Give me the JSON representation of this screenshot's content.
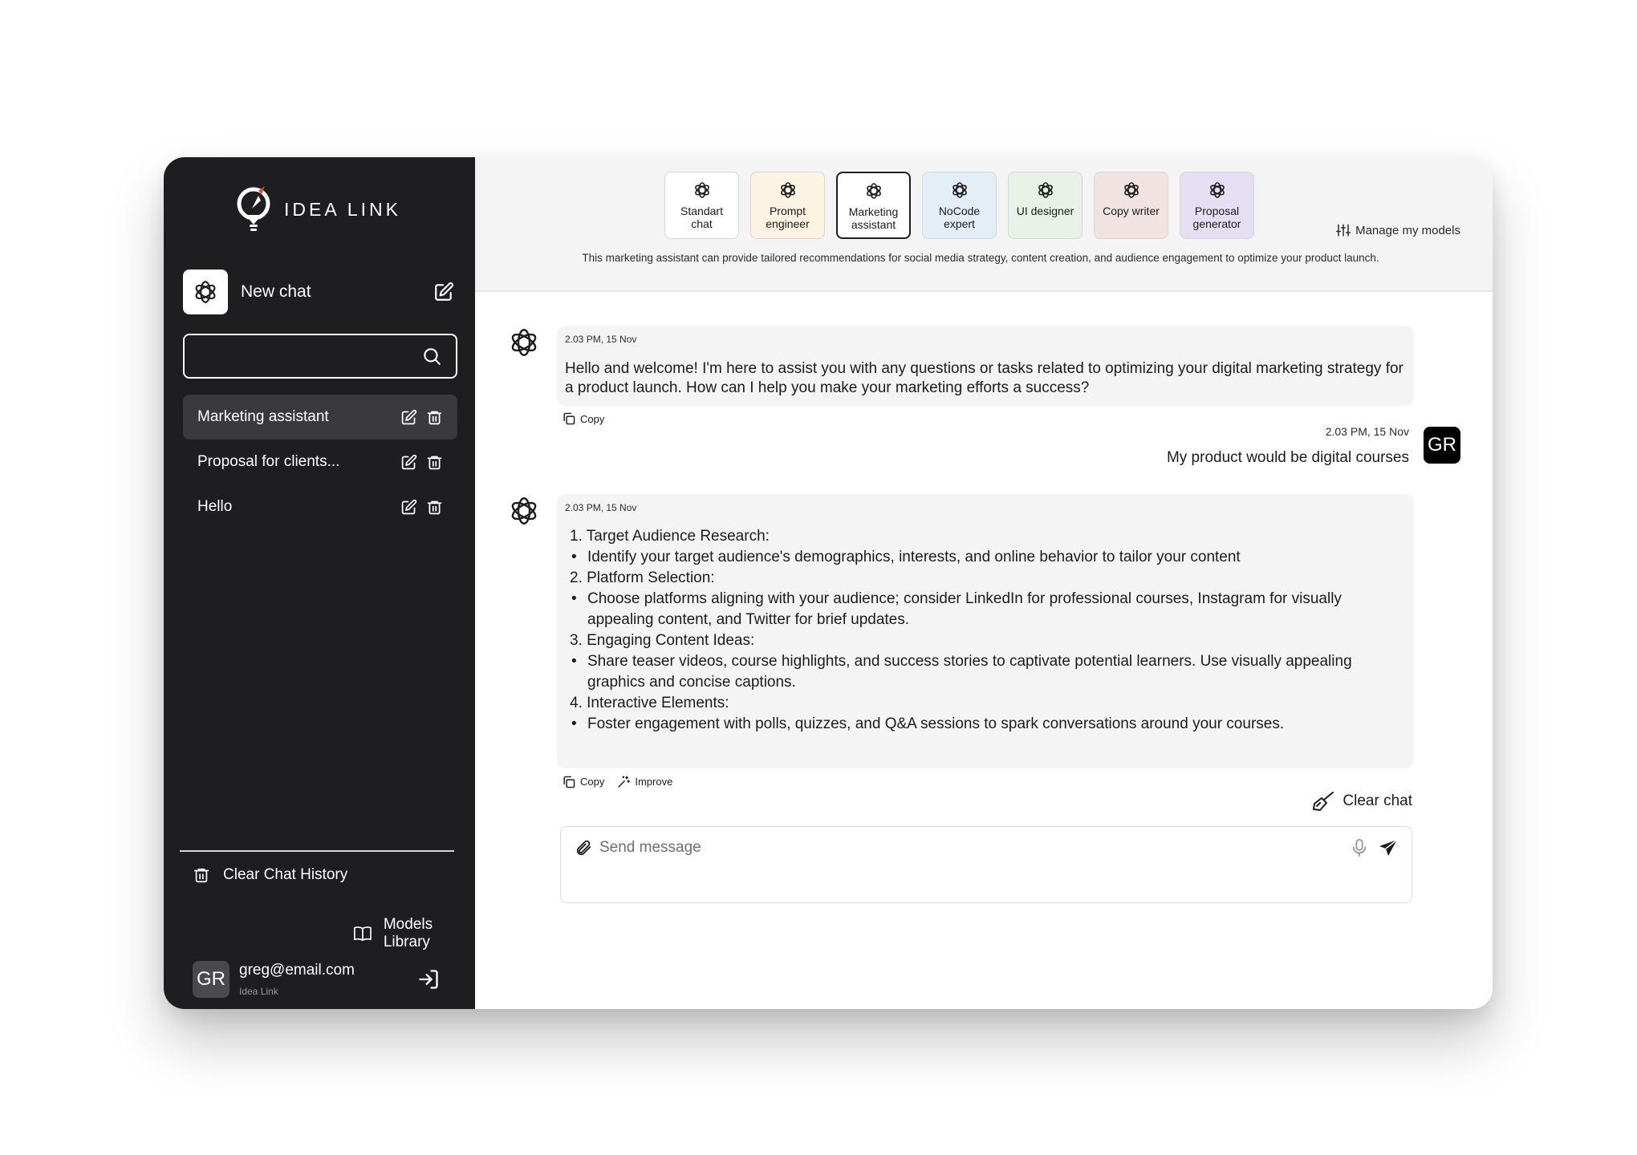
{
  "brand": {
    "name": "IDEA LINK"
  },
  "sidebar": {
    "new_chat_label": "New chat",
    "search_placeholder": "",
    "history": [
      {
        "label": "Marketing assistant",
        "active": true
      },
      {
        "label": "Proposal for clients...",
        "active": false
      },
      {
        "label": "Hello",
        "active": false
      }
    ],
    "clear_history_label": "Clear Chat History",
    "models_library_label": "Models Library",
    "user": {
      "initials": "GR",
      "email": "greg@email.com",
      "org": "Idea Link"
    }
  },
  "models": {
    "items": [
      {
        "label": "Standart chat",
        "line1": "Standart",
        "line2": "chat",
        "bg": "#ffffff",
        "active": false
      },
      {
        "label": "Prompt engineer",
        "line1": "Prompt",
        "line2": "engineer",
        "bg": "#fdf3e3",
        "active": false
      },
      {
        "label": "Marketing assistant",
        "line1": "Marketing",
        "line2": "assistant",
        "bg": "#ffffff",
        "active": true
      },
      {
        "label": "NoCode expert",
        "line1": "NoCode",
        "line2": "expert",
        "bg": "#e3eef6",
        "active": false
      },
      {
        "label": "UI designer",
        "line1": "UI designer",
        "line2": "",
        "bg": "#e8f2e6",
        "active": false
      },
      {
        "label": "Copy writer",
        "line1": "Copy writer",
        "line2": "",
        "bg": "#f2e3e3",
        "active": false
      },
      {
        "label": "Proposal generator",
        "line1": "Proposal",
        "line2": "generator",
        "bg": "#e6def2",
        "active": false
      }
    ],
    "manage_label": "Manage my models",
    "description": "This marketing assistant can provide tailored recommendations for social media strategy, content creation, and audience engagement to optimize your product launch."
  },
  "chat": {
    "messages": [
      {
        "role": "assistant",
        "time": "2.03 PM, 15 Nov",
        "text": "Hello and welcome!  I'm here to assist you with any questions or tasks related to optimizing your digital marketing strategy for a product launch. How can I help you make your marketing efforts a success?",
        "actions": [
          "Copy"
        ]
      },
      {
        "role": "user",
        "time": "2.03 PM, 15 Nov",
        "text": "My product would be digital courses",
        "avatar": "GR"
      },
      {
        "role": "assistant",
        "time": "2.03 PM, 15 Nov",
        "list": [
          {
            "kind": "step",
            "text": "1. Target Audience Research:"
          },
          {
            "kind": "point",
            "text": "Identify your target audience's demographics, interests, and online behavior to tailor your content"
          },
          {
            "kind": "step",
            "text": "2. Platform Selection:"
          },
          {
            "kind": "point",
            "text": "Choose platforms aligning with your audience; consider LinkedIn for professional courses, Instagram for visually appealing content, and Twitter for brief updates."
          },
          {
            "kind": "step",
            "text": "3. Engaging Content Ideas:"
          },
          {
            "kind": "point",
            "text": "Share teaser videos, course highlights, and success stories to captivate potential learners. Use visually appealing graphics and concise captions."
          },
          {
            "kind": "step",
            "text": "4. Interactive Elements:"
          },
          {
            "kind": "point",
            "text": "Foster engagement with polls, quizzes, and Q&A sessions to spark conversations around your courses."
          }
        ],
        "actions": [
          "Copy",
          "Improve"
        ]
      }
    ],
    "clear_chat_label": "Clear chat",
    "composer_placeholder": "Send message"
  },
  "colors": {
    "sidebar_bg": "#1e1e20",
    "topbar_bg": "#f4f4f5",
    "bubble_bg": "#f4f4f5",
    "accent": "#e5432b"
  }
}
